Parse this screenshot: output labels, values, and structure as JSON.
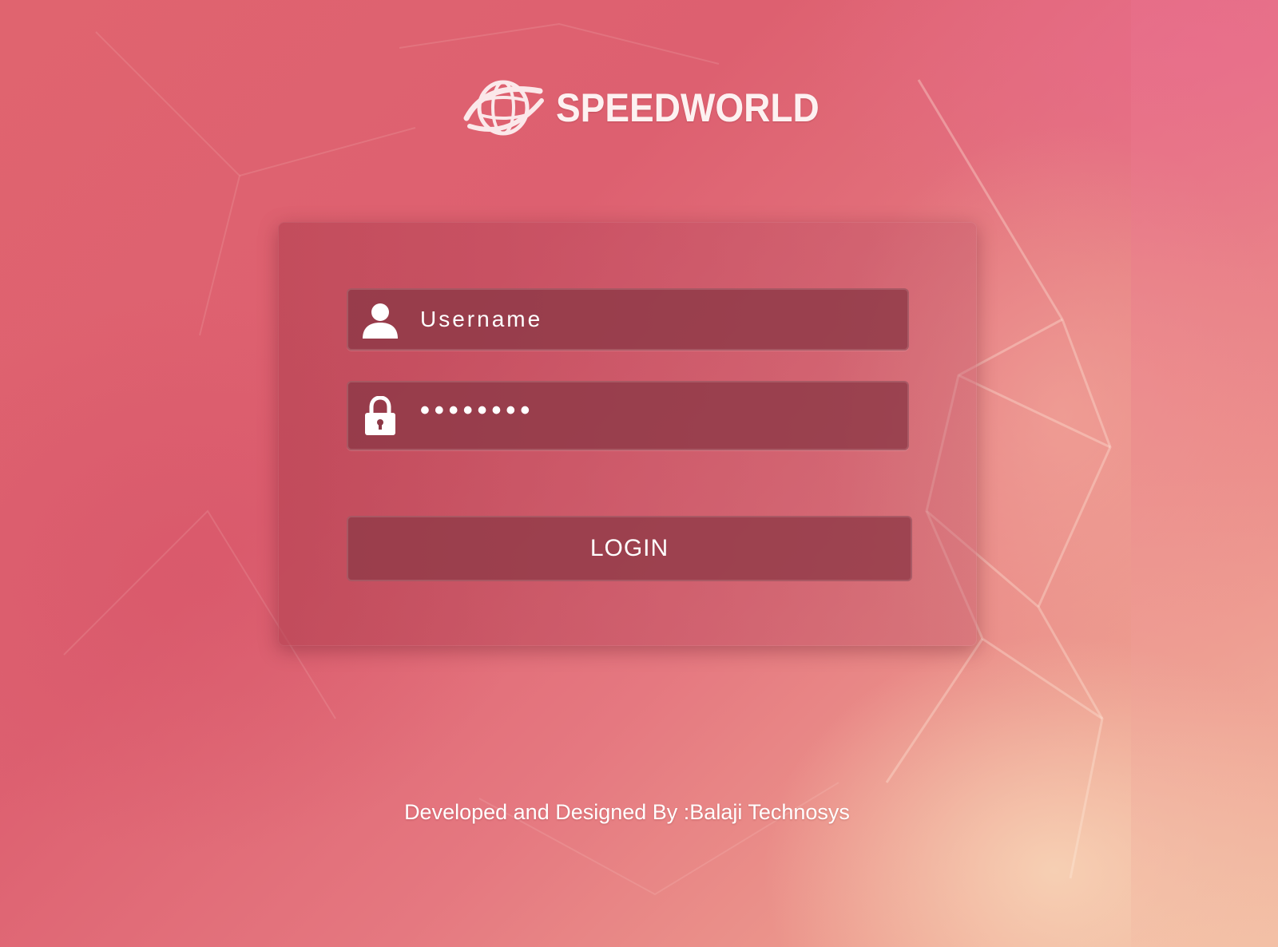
{
  "brand": {
    "name": "SPEEDWORLD",
    "logo_icon": "globe-swoosh-icon"
  },
  "login_form": {
    "username": {
      "placeholder": "Username",
      "value": "",
      "icon": "user-icon"
    },
    "password": {
      "value": "••••••••",
      "icon": "lock-icon"
    },
    "submit_label": "LOGIN"
  },
  "footer": {
    "credit": "Developed and Designed By :Balaji Technosys"
  },
  "colors": {
    "background": "#e0646f",
    "card": "#b24050",
    "field": "#8c3846",
    "text": "#ffffff"
  }
}
